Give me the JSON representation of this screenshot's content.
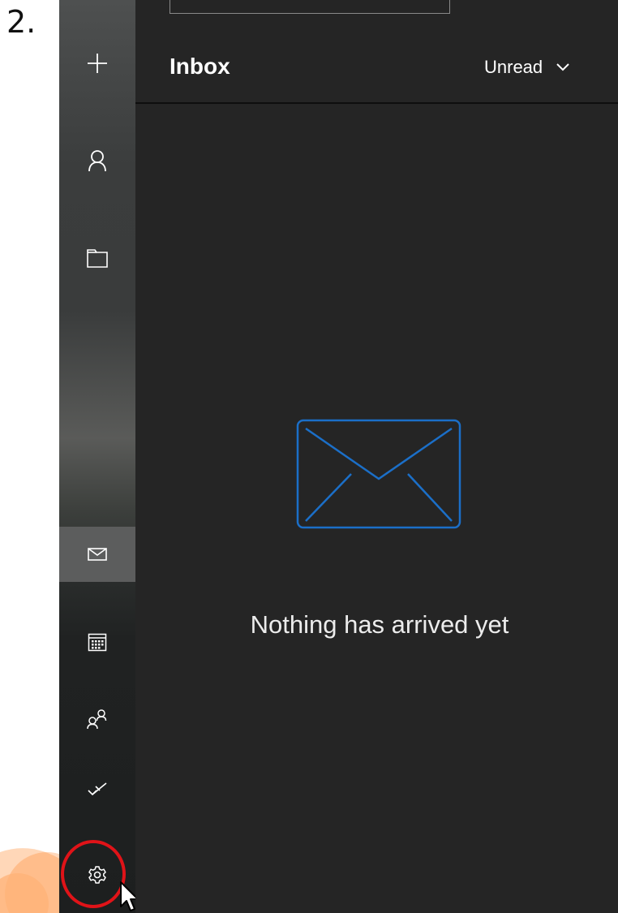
{
  "step_label": "2.",
  "sidebar": {
    "items": [
      {
        "icon": "plus-icon",
        "label": "New mail"
      },
      {
        "icon": "person-icon",
        "label": "Accounts"
      },
      {
        "icon": "folder-icon",
        "label": "Folders"
      },
      {
        "icon": "mail-icon",
        "label": "Mail",
        "active": true
      },
      {
        "icon": "calendar-icon",
        "label": "Calendar"
      },
      {
        "icon": "people-icon",
        "label": "People"
      },
      {
        "icon": "checkmark-icon",
        "label": "To Do"
      },
      {
        "icon": "gear-icon",
        "label": "Settings",
        "highlighted": true
      }
    ]
  },
  "header": {
    "title": "Inbox",
    "filter_label": "Unread"
  },
  "empty_state": {
    "message": "Nothing has arrived yet"
  },
  "colors": {
    "panel_background": "#252525",
    "accent": "#1b6fc8",
    "highlight_ring": "#e01318",
    "brand_mark": "#ff7a1a"
  }
}
